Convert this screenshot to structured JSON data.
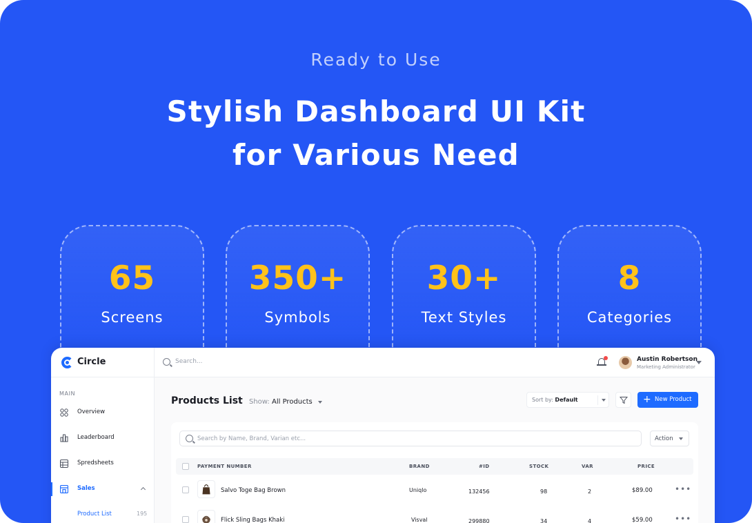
{
  "hero": {
    "eyebrow": "Ready to Use",
    "headline_line1": "Stylish Dashboard UI Kit",
    "headline_line2": "for Various Need"
  },
  "stats": [
    {
      "value": "65",
      "label": "Screens"
    },
    {
      "value": "350+",
      "label": "Symbols"
    },
    {
      "value": "30+",
      "label": "Text Styles"
    },
    {
      "value": "8",
      "label": "Categories"
    }
  ],
  "colors": {
    "background": "#2456F5",
    "accent": "#1E6BFF",
    "stat_number": "#FFC21A"
  },
  "dashboard": {
    "brand": "Circle",
    "search_placeholder": "Search...",
    "user": {
      "name": "Austin Robertson",
      "role": "Marketing Administrator"
    },
    "sidebar": {
      "section": "MAIN",
      "items": [
        {
          "label": "Overview",
          "icon": "grid-icon"
        },
        {
          "label": "Leaderboard",
          "icon": "bar-chart-icon"
        },
        {
          "label": "Spredsheets",
          "icon": "table-icon"
        },
        {
          "label": "Sales",
          "icon": "store-icon"
        }
      ],
      "sub_item": {
        "label": "Product List",
        "count": "195"
      }
    },
    "main": {
      "title": "Products List",
      "show_label": "Show:",
      "show_value": "All Products",
      "sort_label": "Sort by:",
      "sort_value": "Default",
      "new_button": "New Product",
      "table_search_placeholder": "Search by Name, Brand, Varian etc...",
      "action_label": "Action",
      "columns": [
        "PAYMENT NUMBER",
        "BRAND",
        "#ID",
        "STOCK",
        "VAR",
        "PRICE"
      ],
      "rows": [
        {
          "name": "Salvo Toge Bag Brown",
          "brand": "Uniqlo",
          "id": "132456",
          "stock": "98",
          "var": "2",
          "price": "$89.00"
        },
        {
          "name": "Flick Sling Bags Khaki",
          "brand": "Visval",
          "id": "299880",
          "stock": "34",
          "var": "4",
          "price": "$59.00"
        }
      ]
    }
  }
}
